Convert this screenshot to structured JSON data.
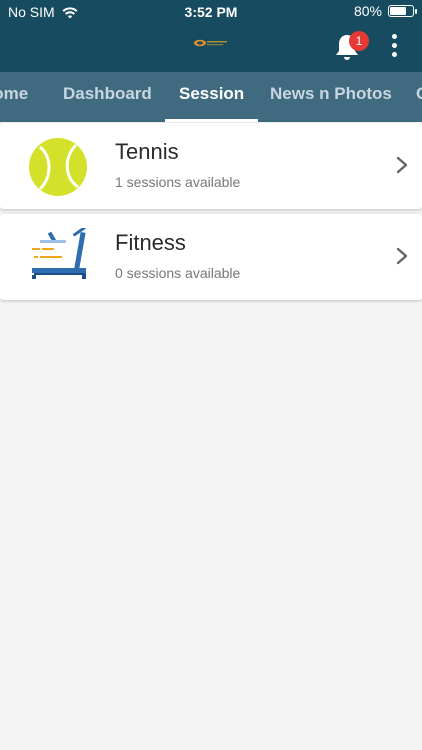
{
  "status_bar": {
    "carrier": "No SIM",
    "time": "3:52 PM",
    "battery": "80%",
    "battery_level": 0.8
  },
  "header": {
    "logo_icon": "app-logo-icon",
    "notification_count": "1",
    "bell_icon": "bell-icon",
    "menu_icon": "more-vertical-icon"
  },
  "tabs": [
    {
      "label": "Home"
    },
    {
      "label": "Dashboard"
    },
    {
      "label": "Session",
      "active": true
    },
    {
      "label": "News n Photos"
    },
    {
      "label": "C"
    }
  ],
  "sessions": [
    {
      "title": "Tennis",
      "subtitle": "1 sessions available",
      "icon": "tennis-ball-icon"
    },
    {
      "title": "Fitness",
      "subtitle": "0 sessions available",
      "icon": "treadmill-icon"
    }
  ],
  "colors": {
    "header_bg": "#174b5f",
    "tabs_bg": "#3f6a80",
    "badge": "#e53935",
    "tennis_ball": "#d4e12a"
  }
}
